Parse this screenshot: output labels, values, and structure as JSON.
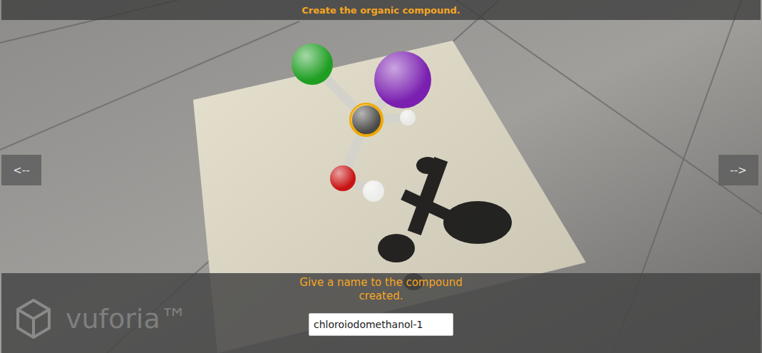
{
  "top_bar": {
    "title": "Create the organic compound."
  },
  "nav": {
    "prev": "<--",
    "next": "-->"
  },
  "molecule": {
    "atoms": [
      {
        "color": "#1f9e22",
        "selected": false
      },
      {
        "color": "#7a1fb0",
        "selected": false
      },
      {
        "color": "#4a4a48",
        "selected": true
      },
      {
        "color": "#e8e8e4",
        "selected": false
      },
      {
        "color": "#c91414",
        "selected": false
      },
      {
        "color": "#ececea",
        "selected": false
      }
    ]
  },
  "name_prompt": {
    "label": "Give a name to the compound created.",
    "value": "chloroiodomethanol-1"
  },
  "watermark": {
    "text": "vuforia™"
  }
}
